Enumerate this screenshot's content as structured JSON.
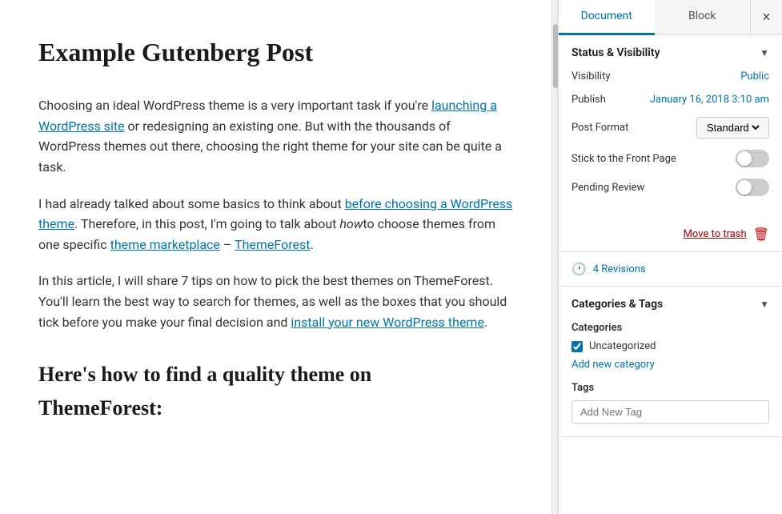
{
  "tabs": {
    "document_label": "Document",
    "block_label": "Block",
    "close_icon": "×"
  },
  "sidebar": {
    "status_visibility": {
      "header": "Status & Visibility",
      "visibility_label": "Visibility",
      "visibility_value": "Public",
      "publish_label": "Publish",
      "publish_value": "January 16, 2018 3:10 am",
      "post_format_label": "Post Format",
      "post_format_value": "Standard",
      "stick_front_label": "Stick to the Front Page",
      "pending_review_label": "Pending Review",
      "move_to_trash_label": "Move to trash"
    },
    "revisions_label": "4 Revisions",
    "categories_tags": {
      "header": "Categories & Tags",
      "categories_label": "Categories",
      "category_uncategorized": "Uncategorized",
      "add_category_label": "Add new category",
      "tags_label": "Tags",
      "tags_placeholder": "Add New Tag"
    }
  },
  "content": {
    "title": "Example Gutenberg Post",
    "paragraph1": "Choosing an ideal WordPress theme is a very important task if you're ",
    "link1": "launching a WordPress site",
    "paragraph1b": " or redesigning an existing one. But with the thousands of WordPress themes out there, choosing the right theme for your site can be quite a task.",
    "paragraph2": "I had already talked about some basics to think about ",
    "link2": "before choosing a WordPress theme",
    "paragraph2b": ". Therefore, in this post, I'm going to talk about ",
    "paragraph2_em": "how",
    "paragraph2c": "to choose themes from one specific ",
    "link3": "theme marketplace",
    "paragraph2d": " – ",
    "link4": "ThemeForest",
    "paragraph2e": ".",
    "paragraph3": "In this article, I will share 7 tips on how to pick the best themes on ThemeForest. You'll learn the best way to search for themes, as well as the boxes that you should tick before you make your final decision and ",
    "link5": "install your new WordPress theme",
    "paragraph3b": ".",
    "heading2_line1": "Here's how to find a quality theme on",
    "heading2_line2": "ThemeForest:"
  }
}
